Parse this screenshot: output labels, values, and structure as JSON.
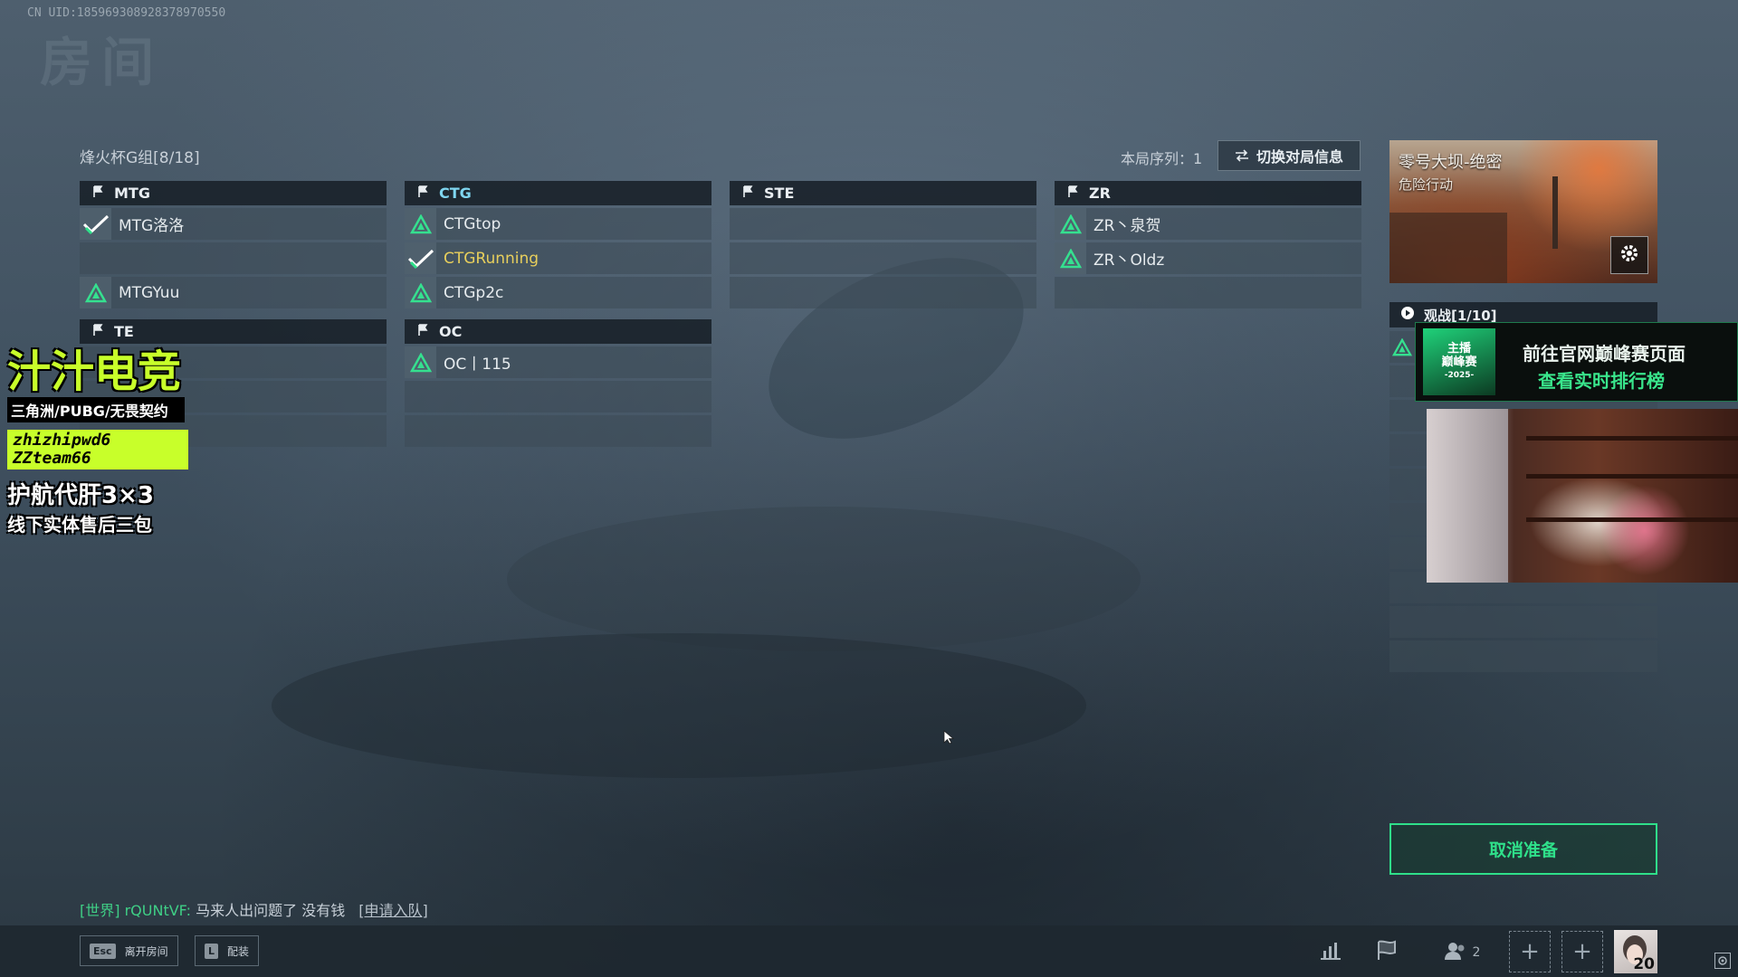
{
  "uid_text": "CN UID:1859693089283789705​50",
  "room_watermark": "房间",
  "lobby": {
    "group_title": "烽火杯G组[8/18]",
    "round_label": "本局序列：1",
    "switch_button": "切换对局信息"
  },
  "teams": [
    {
      "name": "MTG",
      "is_self": false,
      "slots": [
        {
          "player": "MTG洛洛",
          "status": "ready"
        },
        {
          "player": "",
          "status": "empty"
        },
        {
          "player": "MTGYuu",
          "status": "member"
        }
      ]
    },
    {
      "name": "CTG",
      "is_self": true,
      "slots": [
        {
          "player": "CTGtop",
          "status": "member"
        },
        {
          "player": "CTGRunning",
          "status": "ready",
          "highlight": true
        },
        {
          "player": "CTGp2c",
          "status": "member"
        }
      ]
    },
    {
      "name": "STE",
      "is_self": false,
      "slots": [
        {
          "player": "",
          "status": "empty"
        },
        {
          "player": "",
          "status": "empty"
        },
        {
          "player": "",
          "status": "empty"
        }
      ]
    },
    {
      "name": "ZR",
      "is_self": false,
      "slots": [
        {
          "player": "ZR丶泉贺",
          "status": "member"
        },
        {
          "player": "ZR丶Oldz",
          "status": "member"
        },
        {
          "player": "",
          "status": "empty"
        }
      ]
    },
    {
      "name": "TE",
      "is_self": false,
      "slots": [
        {
          "player": "",
          "status": "empty"
        },
        {
          "player": "",
          "status": "empty"
        },
        {
          "player": "",
          "status": "empty"
        }
      ]
    },
    {
      "name": "OC",
      "is_self": false,
      "slots": [
        {
          "player": "OC丨115",
          "status": "member"
        },
        {
          "player": "",
          "status": "empty"
        },
        {
          "player": "",
          "status": "empty"
        }
      ]
    }
  ],
  "map": {
    "name": "零号大坝-绝密",
    "mode": "危险行动",
    "settings_icon": "gear-icon"
  },
  "spectate": {
    "label": "观战[1/10]",
    "icon": "play-icon"
  },
  "promo": {
    "logo_line1": "主播",
    "logo_line2": "巅峰赛",
    "logo_line3": "-2025-",
    "line1": "前往官网巅峰赛页面",
    "line2": "查看实时排行榜"
  },
  "brand_overlay": {
    "name": "汁汁电竞",
    "games": "三角洲/PUBG/无畏契约",
    "wechat_line1": "zhizhipwd6",
    "wechat_line2": "ZZteam66",
    "service_line1": "护航代肝3×3",
    "service_line2": "线下实体售后三包"
  },
  "chat": {
    "channel": "[世界]",
    "user": "rQUNtVF:",
    "message": "马来人出问题了 没有钱",
    "action": "[申请入队]"
  },
  "cancel_ready_label": "取消准备",
  "bottom_bar": {
    "leave_key": "Esc",
    "leave_label": "离开房间",
    "loadout_key": "L",
    "loadout_label": "配装",
    "friends_count": "2",
    "player_level": "20"
  },
  "colors": {
    "accent_green": "#2fe08a",
    "self_team": "#7fd6f0",
    "self_player": "#e8cf5c",
    "brand_lime": "#c8ff2a"
  }
}
